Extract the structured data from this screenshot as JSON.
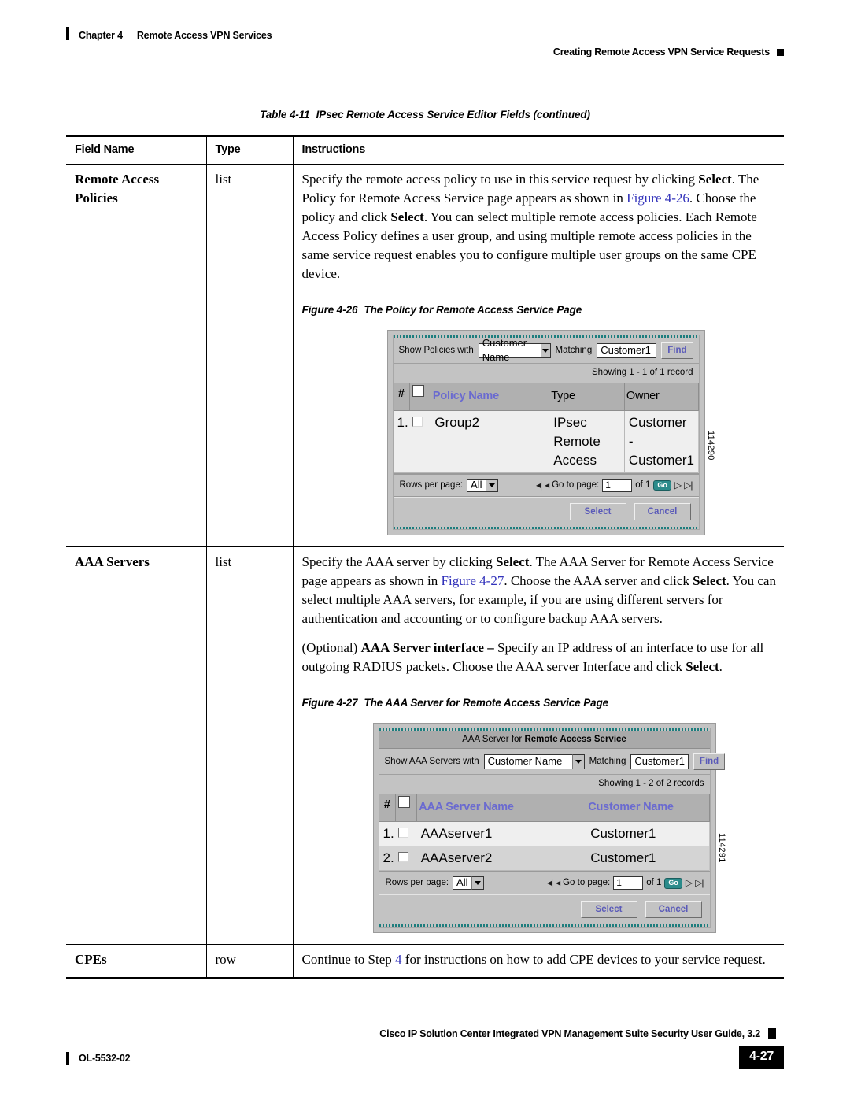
{
  "running_head": {
    "chapter": "Chapter 4",
    "chapter_title": "Remote Access VPN Services",
    "section": "Creating Remote Access VPN Service Requests"
  },
  "table_caption": {
    "number": "Table 4-11",
    "title": "IPsec Remote Access Service Editor Fields (continued)"
  },
  "table_headers": {
    "field_name": "Field Name",
    "type": "Type",
    "instructions": "Instructions"
  },
  "rows": {
    "remote_access_policies": {
      "field_name": "Remote Access Policies",
      "type": "list",
      "paragraph_1": {
        "seg1": "Specify the remote access policy to use in this service request by clicking ",
        "bold1": "Select",
        "seg2": ". The Policy for Remote Access Service page appears as shown in ",
        "xref": "Figure 4-26",
        "seg3": ". Choose the policy and click ",
        "bold2": "Select",
        "seg4": ". You can select multiple remote access policies. Each Remote Access Policy defines a user group, and using multiple remote access policies in the same service request enables you to configure multiple user groups on the same CPE device."
      }
    },
    "aaa_servers": {
      "field_name": "AAA Servers",
      "type": "list",
      "paragraph_1": {
        "seg1": "Specify the AAA server by clicking ",
        "bold1": "Select",
        "seg2": ". The AAA Server for Remote Access Service page appears as shown in ",
        "xref": "Figure 4-27",
        "seg3": ". Choose the AAA server and click ",
        "bold2": "Select",
        "seg4": ". You can select multiple AAA servers, for example, if you are using different servers for authentication and accounting or to configure backup AAA servers."
      },
      "paragraph_2": {
        "seg1": "(Optional) ",
        "bold1": "AAA Server interface –",
        "seg2": " Specify an IP address of an interface to use for all outgoing RADIUS packets. Choose the AAA server Interface and click ",
        "bold2": "Select",
        "seg3": "."
      }
    },
    "cpes": {
      "field_name": "CPEs",
      "type": "row",
      "paragraph_1": {
        "seg1": "Continue to Step ",
        "xref": "4",
        "seg2": " for instructions on how to add CPE devices to your service request."
      }
    }
  },
  "figure_26": {
    "caption_number": "Figure 4-26",
    "caption_title": "The Policy for Remote Access Service Page",
    "art_id": "114290",
    "search": {
      "label": "Show Policies with",
      "select_value": "Customer Name",
      "matching_label": "Matching",
      "input_value": "Customer1",
      "find_button": "Find"
    },
    "showing": "Showing 1 - 1 of 1 record",
    "columns": [
      "#",
      "",
      "Policy Name",
      "Type",
      "Owner"
    ],
    "rows": [
      {
        "num": "1.",
        "policy_name": "Group2",
        "type": "IPsec Remote Access",
        "owner": "Customer - Customer1"
      }
    ],
    "pager": {
      "rows_per_page_label": "Rows per page:",
      "rows_per_page_value": "All",
      "goto_label": "Go to page:",
      "page_value": "1",
      "of_label": "of 1",
      "go_button": "Go"
    },
    "actions": {
      "select": "Select",
      "cancel": "Cancel"
    }
  },
  "figure_27": {
    "caption_number": "Figure 4-27",
    "caption_title": "The AAA Server for Remote Access Service Page",
    "art_id": "114291",
    "title_prefix": "AAA Server for ",
    "title_bold": "Remote Access Service",
    "search": {
      "label": "Show AAA Servers with",
      "select_value": "Customer Name",
      "matching_label": "Matching",
      "input_value": "Customer1",
      "find_button": "Find"
    },
    "showing": "Showing 1 - 2 of 2 records",
    "columns": [
      "#",
      "",
      "AAA Server Name",
      "Customer Name"
    ],
    "rows": [
      {
        "num": "1.",
        "server_name": "AAAserver1",
        "customer_name": "Customer1"
      },
      {
        "num": "2.",
        "server_name": "AAAserver2",
        "customer_name": "Customer1"
      }
    ],
    "pager": {
      "rows_per_page_label": "Rows per page:",
      "rows_per_page_value": "All",
      "goto_label": "Go to page:",
      "page_value": "1",
      "of_label": "of 1",
      "go_button": "Go"
    },
    "actions": {
      "select": "Select",
      "cancel": "Cancel"
    }
  },
  "footer": {
    "title": "Cisco IP Solution Center Integrated VPN Management Suite Security User Guide, 3.2",
    "doc_number": "OL-5532-02",
    "page_number": "4-27"
  },
  "colors": {
    "xref_blue": "#3333bb",
    "ui_gray": "#c3c3c3",
    "header_gray": "#b0b0b0",
    "link_purple": "#6a6ad0",
    "teal": "#2b8b8b"
  }
}
